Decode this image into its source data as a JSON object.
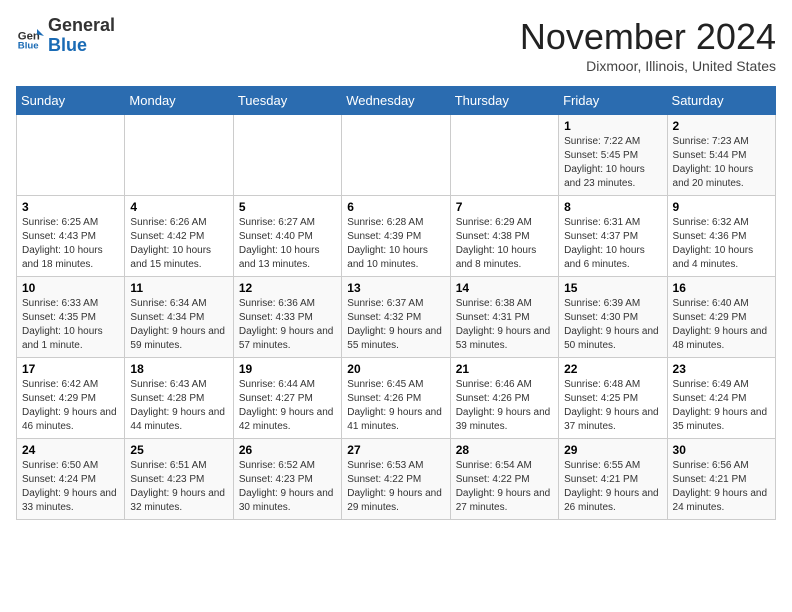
{
  "logo": {
    "general": "General",
    "blue": "Blue"
  },
  "title": "November 2024",
  "location": "Dixmoor, Illinois, United States",
  "weekdays": [
    "Sunday",
    "Monday",
    "Tuesday",
    "Wednesday",
    "Thursday",
    "Friday",
    "Saturday"
  ],
  "weeks": [
    [
      {
        "day": "",
        "info": ""
      },
      {
        "day": "",
        "info": ""
      },
      {
        "day": "",
        "info": ""
      },
      {
        "day": "",
        "info": ""
      },
      {
        "day": "",
        "info": ""
      },
      {
        "day": "1",
        "info": "Sunrise: 7:22 AM\nSunset: 5:45 PM\nDaylight: 10 hours and 23 minutes."
      },
      {
        "day": "2",
        "info": "Sunrise: 7:23 AM\nSunset: 5:44 PM\nDaylight: 10 hours and 20 minutes."
      }
    ],
    [
      {
        "day": "3",
        "info": "Sunrise: 6:25 AM\nSunset: 4:43 PM\nDaylight: 10 hours and 18 minutes."
      },
      {
        "day": "4",
        "info": "Sunrise: 6:26 AM\nSunset: 4:42 PM\nDaylight: 10 hours and 15 minutes."
      },
      {
        "day": "5",
        "info": "Sunrise: 6:27 AM\nSunset: 4:40 PM\nDaylight: 10 hours and 13 minutes."
      },
      {
        "day": "6",
        "info": "Sunrise: 6:28 AM\nSunset: 4:39 PM\nDaylight: 10 hours and 10 minutes."
      },
      {
        "day": "7",
        "info": "Sunrise: 6:29 AM\nSunset: 4:38 PM\nDaylight: 10 hours and 8 minutes."
      },
      {
        "day": "8",
        "info": "Sunrise: 6:31 AM\nSunset: 4:37 PM\nDaylight: 10 hours and 6 minutes."
      },
      {
        "day": "9",
        "info": "Sunrise: 6:32 AM\nSunset: 4:36 PM\nDaylight: 10 hours and 4 minutes."
      }
    ],
    [
      {
        "day": "10",
        "info": "Sunrise: 6:33 AM\nSunset: 4:35 PM\nDaylight: 10 hours and 1 minute."
      },
      {
        "day": "11",
        "info": "Sunrise: 6:34 AM\nSunset: 4:34 PM\nDaylight: 9 hours and 59 minutes."
      },
      {
        "day": "12",
        "info": "Sunrise: 6:36 AM\nSunset: 4:33 PM\nDaylight: 9 hours and 57 minutes."
      },
      {
        "day": "13",
        "info": "Sunrise: 6:37 AM\nSunset: 4:32 PM\nDaylight: 9 hours and 55 minutes."
      },
      {
        "day": "14",
        "info": "Sunrise: 6:38 AM\nSunset: 4:31 PM\nDaylight: 9 hours and 53 minutes."
      },
      {
        "day": "15",
        "info": "Sunrise: 6:39 AM\nSunset: 4:30 PM\nDaylight: 9 hours and 50 minutes."
      },
      {
        "day": "16",
        "info": "Sunrise: 6:40 AM\nSunset: 4:29 PM\nDaylight: 9 hours and 48 minutes."
      }
    ],
    [
      {
        "day": "17",
        "info": "Sunrise: 6:42 AM\nSunset: 4:29 PM\nDaylight: 9 hours and 46 minutes."
      },
      {
        "day": "18",
        "info": "Sunrise: 6:43 AM\nSunset: 4:28 PM\nDaylight: 9 hours and 44 minutes."
      },
      {
        "day": "19",
        "info": "Sunrise: 6:44 AM\nSunset: 4:27 PM\nDaylight: 9 hours and 42 minutes."
      },
      {
        "day": "20",
        "info": "Sunrise: 6:45 AM\nSunset: 4:26 PM\nDaylight: 9 hours and 41 minutes."
      },
      {
        "day": "21",
        "info": "Sunrise: 6:46 AM\nSunset: 4:26 PM\nDaylight: 9 hours and 39 minutes."
      },
      {
        "day": "22",
        "info": "Sunrise: 6:48 AM\nSunset: 4:25 PM\nDaylight: 9 hours and 37 minutes."
      },
      {
        "day": "23",
        "info": "Sunrise: 6:49 AM\nSunset: 4:24 PM\nDaylight: 9 hours and 35 minutes."
      }
    ],
    [
      {
        "day": "24",
        "info": "Sunrise: 6:50 AM\nSunset: 4:24 PM\nDaylight: 9 hours and 33 minutes."
      },
      {
        "day": "25",
        "info": "Sunrise: 6:51 AM\nSunset: 4:23 PM\nDaylight: 9 hours and 32 minutes."
      },
      {
        "day": "26",
        "info": "Sunrise: 6:52 AM\nSunset: 4:23 PM\nDaylight: 9 hours and 30 minutes."
      },
      {
        "day": "27",
        "info": "Sunrise: 6:53 AM\nSunset: 4:22 PM\nDaylight: 9 hours and 29 minutes."
      },
      {
        "day": "28",
        "info": "Sunrise: 6:54 AM\nSunset: 4:22 PM\nDaylight: 9 hours and 27 minutes."
      },
      {
        "day": "29",
        "info": "Sunrise: 6:55 AM\nSunset: 4:21 PM\nDaylight: 9 hours and 26 minutes."
      },
      {
        "day": "30",
        "info": "Sunrise: 6:56 AM\nSunset: 4:21 PM\nDaylight: 9 hours and 24 minutes."
      }
    ]
  ]
}
